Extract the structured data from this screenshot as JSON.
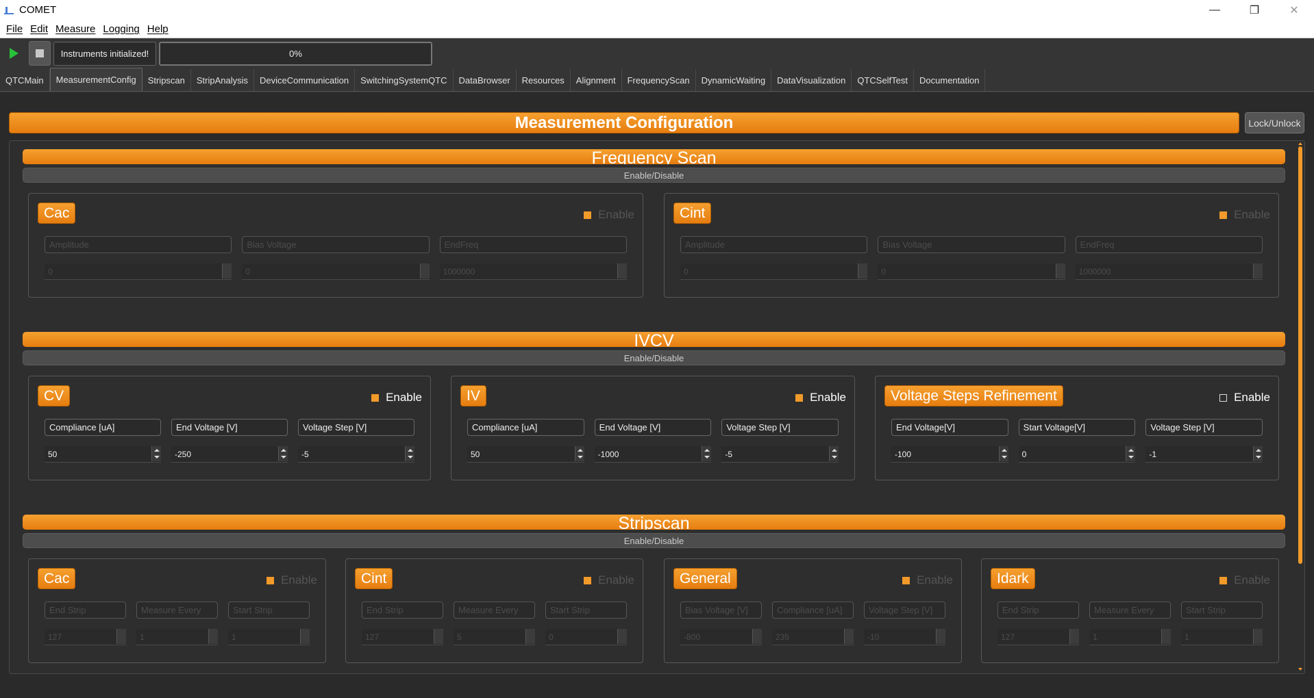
{
  "window": {
    "title": "COMET",
    "minimize": "—",
    "restore": "❐",
    "close": "✕"
  },
  "menu": {
    "file": "File",
    "edit": "Edit",
    "measure": "Measure",
    "logging": "Logging",
    "help": "Help"
  },
  "toolbar": {
    "status": "Instruments initialized!",
    "progress": "0%"
  },
  "tabs": [
    "QTCMain",
    "MeasurementConfig",
    "Stripscan",
    "StripAnalysis",
    "DeviceCommunication",
    "SwitchingSystemQTC",
    "DataBrowser",
    "Resources",
    "Alignment",
    "FrequencyScan",
    "DynamicWaiting",
    "DataVisualization",
    "QTCSelfTest",
    "Documentation"
  ],
  "main": {
    "header": "Measurement Configuration",
    "lock_button": "Lock/Unlock",
    "enable_disable": "Enable/Disable"
  },
  "sections": {
    "frequency": {
      "title": "Frequency Scan",
      "groups": [
        {
          "title": "Cac",
          "check": "Enable",
          "fields": [
            {
              "label": "Amplitude",
              "value": "0"
            },
            {
              "label": "Bias Voltage",
              "value": "0"
            },
            {
              "label": "EndFreq",
              "value": "1000000"
            }
          ]
        },
        {
          "title": "Cint",
          "check": "Enable",
          "fields": [
            {
              "label": "Amplitude",
              "value": "0"
            },
            {
              "label": "Bias Voltage",
              "value": "0"
            },
            {
              "label": "EndFreq",
              "value": "1000000"
            }
          ]
        }
      ]
    },
    "ivcv": {
      "title": "IVCV",
      "groups": [
        {
          "title": "CV",
          "check": "Enable",
          "fields": [
            {
              "label": "Compliance [uA]",
              "value": "50"
            },
            {
              "label": "End Voltage [V]",
              "value": "-250"
            },
            {
              "label": "Voltage Step [V]",
              "value": "-5"
            }
          ]
        },
        {
          "title": "IV",
          "check": "Enable",
          "fields": [
            {
              "label": "Compliance [uA]",
              "value": "50"
            },
            {
              "label": "End Voltage [V]",
              "value": "-1000"
            },
            {
              "label": "Voltage Step [V]",
              "value": "-5"
            }
          ]
        },
        {
          "title": "Voltage Steps Refinement",
          "check": "Enable",
          "fields": [
            {
              "label": "End Voltage[V]",
              "value": "-100"
            },
            {
              "label": "Start Voltage[V]",
              "value": "0"
            },
            {
              "label": "Voltage Step [V]",
              "value": "-1"
            }
          ]
        }
      ]
    },
    "stripscan": {
      "title": "Stripscan",
      "groups": [
        {
          "title": "Cac",
          "check": "Enable",
          "fields": [
            {
              "label": "End Strip",
              "value": "127"
            },
            {
              "label": "Measure Every",
              "value": "1"
            },
            {
              "label": "Start Strip",
              "value": "1"
            }
          ]
        },
        {
          "title": "Cint",
          "check": "Enable",
          "fields": [
            {
              "label": "End Strip",
              "value": "127"
            },
            {
              "label": "Measure Every",
              "value": "5"
            },
            {
              "label": "Start Strip",
              "value": "0"
            }
          ]
        },
        {
          "title": "General",
          "check": "Enable",
          "fields": [
            {
              "label": "Bias Voltage [V]",
              "value": "-800"
            },
            {
              "label": "Compliance [uA]",
              "value": "235"
            },
            {
              "label": "Voltage Step [V]",
              "value": "-10"
            }
          ]
        },
        {
          "title": "Idark",
          "check": "Enable",
          "fields": [
            {
              "label": "End Strip",
              "value": "127"
            },
            {
              "label": "Measure Every",
              "value": "1"
            },
            {
              "label": "Start Strip",
              "value": "1"
            }
          ]
        }
      ]
    }
  }
}
